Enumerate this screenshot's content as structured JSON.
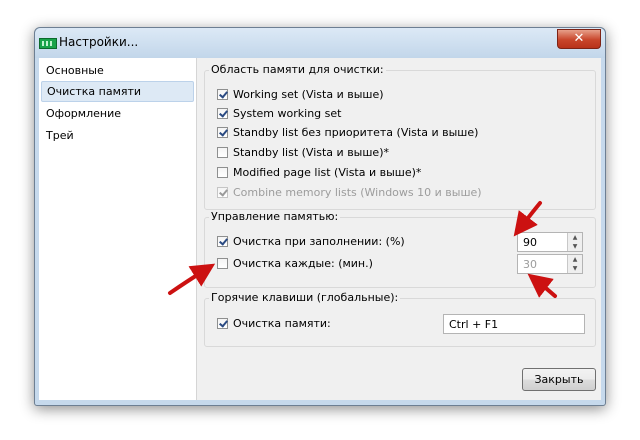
{
  "window": {
    "title": "Настройки...",
    "close_glyph": "✕"
  },
  "sidebar": {
    "items": [
      {
        "label": "Основные"
      },
      {
        "label": "Очистка памяти"
      },
      {
        "label": "Оформление"
      },
      {
        "label": "Трей"
      }
    ],
    "selected_index": 1
  },
  "memory_area": {
    "title": "Область памяти для очистки:",
    "options": [
      {
        "label": "Working set (Vista и выше)",
        "checked": true,
        "enabled": true
      },
      {
        "label": "System working set",
        "checked": true,
        "enabled": true
      },
      {
        "label": "Standby list без приоритета (Vista и выше)",
        "checked": true,
        "enabled": true
      },
      {
        "label": "Standby list (Vista и выше)*",
        "checked": false,
        "enabled": true
      },
      {
        "label": "Modified page list (Vista и выше)*",
        "checked": false,
        "enabled": true
      },
      {
        "label": "Combine memory lists (Windows 10 и выше)",
        "checked": true,
        "enabled": false
      }
    ]
  },
  "memory_management": {
    "title": "Управление памятью:",
    "on_fill": {
      "label": "Очистка при заполнении: (%)",
      "checked": true,
      "value": "90"
    },
    "interval": {
      "label": "Очистка каждые: (мин.)",
      "checked": false,
      "value": "30"
    }
  },
  "hotkeys": {
    "title": "Горячие клавиши (глобальные):",
    "clean": {
      "label": "Очистка памяти:",
      "checked": true,
      "value": "Ctrl + F1"
    }
  },
  "footer": {
    "close_label": "Закрыть"
  },
  "colors": {
    "annotation_arrow": "#cc1111",
    "selection": "#dde9f5",
    "app_icon": "#19a34a"
  }
}
